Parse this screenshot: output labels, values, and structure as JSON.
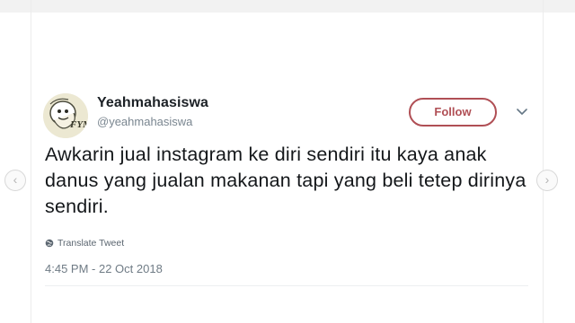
{
  "tweet": {
    "display_name": "Yeahmahasiswa",
    "handle": "@yeahmahasiswa",
    "follow_label": "Follow",
    "text": "Awkarin jual instagram ke diri sendiri itu kaya anak danus yang jualan makanan tapi yang beli tetep dirinya sendiri.",
    "translate_label": "Translate Tweet",
    "timestamp": "4:45 PM - 22 Oct 2018"
  },
  "avatar": {
    "badge_text": "FYM"
  },
  "icons": {
    "caret": "chevron-down-icon",
    "translate": "globe-icon",
    "prev": "chevron-left-icon",
    "next": "chevron-right-icon"
  },
  "colors": {
    "follow_accent": "#b04f55",
    "text": "#14171a",
    "muted": "#6f7b85"
  }
}
